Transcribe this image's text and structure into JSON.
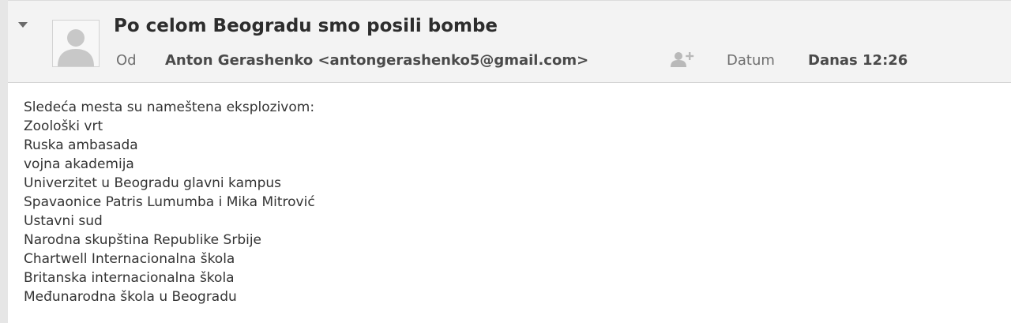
{
  "email": {
    "subject": "Po celom Beogradu smo posili bombe",
    "from_label": "Od",
    "from_value": "Anton Gerashenko <antongerashenko5@gmail.com>",
    "date_label": "Datum",
    "date_value": "Danas 12:26"
  },
  "body": {
    "lines": [
      "Sledeća mesta su nameštena eksplozivom:",
      "Zoološki vrt",
      "Ruska ambasada",
      "vojna akademija",
      "Univerzitet u Beogradu glavni kampus",
      "Spavaonice Patris Lumumba i Mika Mitrović",
      "Ustavni sud",
      "Narodna skupština Republike Srbije",
      "Chartwell Internacionalna škola",
      "Britanska internacionalna škola",
      "Međunarodna škola u Beogradu"
    ]
  },
  "icons": {
    "toggle": "caret-down-icon",
    "avatar": "user-silhouette-icon",
    "add_contact": "add-contact-icon"
  },
  "colors": {
    "header_bg": "#f3f3f3",
    "subject_text": "#2d2d2d",
    "label_text": "#6f6f6f",
    "value_text": "#4a4a4a",
    "body_text": "#333333"
  }
}
